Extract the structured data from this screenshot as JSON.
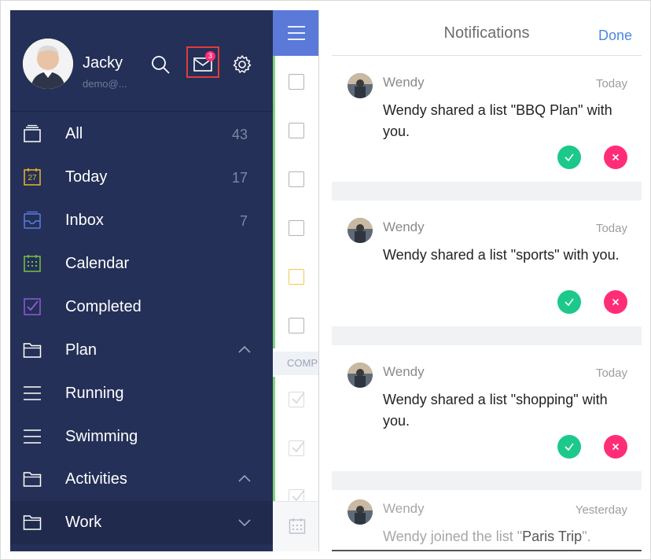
{
  "profile": {
    "name": "Jacky",
    "email": "demo@..."
  },
  "header": {
    "mail_badge_count": "3"
  },
  "nav": [
    {
      "label": "All",
      "count": "43",
      "icon": "stack-icon"
    },
    {
      "label": "Today",
      "count": "17",
      "icon": "calendar-day-icon",
      "day": "27"
    },
    {
      "label": "Inbox",
      "count": "7",
      "icon": "inbox-icon"
    },
    {
      "label": "Calendar",
      "count": "",
      "icon": "calendar-grid-icon"
    },
    {
      "label": "Completed",
      "count": "",
      "icon": "checkbox-checked-icon"
    },
    {
      "label": "Plan",
      "count": "",
      "icon": "folder-icon",
      "chevron": "up"
    },
    {
      "label": "Running",
      "count": "",
      "icon": "list-icon"
    },
    {
      "label": "Swimming",
      "count": "",
      "icon": "list-icon"
    },
    {
      "label": "Activities",
      "count": "",
      "icon": "folder-icon",
      "chevron": "up"
    },
    {
      "label": "Work",
      "count": "",
      "icon": "folder-icon",
      "chevron": "down"
    }
  ],
  "strip": {
    "section_label": "COMP"
  },
  "notifications": {
    "title": "Notifications",
    "done_label": "Done",
    "items": [
      {
        "sender": "Wendy",
        "time": "Today",
        "message": "Wendy shared a list \"BBQ Plan\" with you."
      },
      {
        "sender": "Wendy",
        "time": "Today",
        "message": "Wendy shared a list \"sports\" with you."
      },
      {
        "sender": "Wendy",
        "time": "Today",
        "message": "Wendy shared a list \"shopping\" with you."
      },
      {
        "sender": "Wendy",
        "time": "Yesterday",
        "message_prefix": "Wendy joined the list \"",
        "message_highlight": "Paris Trip",
        "message_suffix": "\"."
      }
    ]
  },
  "colors": {
    "sidebar_bg": "#243057",
    "accent_blue": "#5a79d8",
    "accept_green": "#1cc98a",
    "reject_pink": "#ff2d78",
    "done_blue": "#4a89dc"
  }
}
